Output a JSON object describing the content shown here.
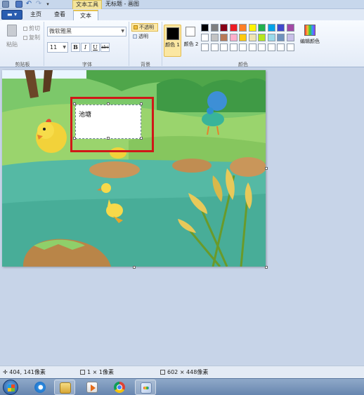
{
  "titlebar": {
    "context_tab": "文本工具",
    "window_title": "无标题 - 画图",
    "icons": [
      "app-menu-icon",
      "save-icon",
      "undo-icon",
      "redo-icon",
      "customize-dropdown-icon"
    ]
  },
  "tabs": {
    "file_icon": "file-menu-icon",
    "home": "主页",
    "view": "查看",
    "text": "文本"
  },
  "ribbon": {
    "clipboard": {
      "paste": "粘贴",
      "cut": "剪切",
      "copy": "复制",
      "group_label": "剪贴板"
    },
    "font": {
      "family": "微软雅黑",
      "size": "11",
      "bold": "B",
      "italic": "I",
      "underline": "U",
      "strikethrough": "abc",
      "group_label": "字体"
    },
    "background": {
      "opaque": "不透明",
      "transparent": "透明",
      "group_label": "背景"
    },
    "colors": {
      "color1_label": "颜色 1",
      "color2_label": "颜色 2",
      "color1_value": "#000000",
      "color2_value": "#ffffff",
      "edit_colors": "编辑颜色",
      "group_label": "颜色",
      "palette": [
        "#000000",
        "#7f7f7f",
        "#880015",
        "#ed1c24",
        "#ff7f27",
        "#fff200",
        "#22b14c",
        "#00a2e8",
        "#3f48cc",
        "#a349a4",
        "#ffffff",
        "#c3c3c3",
        "#b97a57",
        "#ffaec9",
        "#ffc90e",
        "#efe4b0",
        "#b5e61d",
        "#99d9ea",
        "#7092be",
        "#c8bfe7",
        "#ffffff",
        "#ffffff",
        "#ffffff",
        "#ffffff",
        "#ffffff",
        "#ffffff",
        "#ffffff",
        "#ffffff",
        "#ffffff",
        "#ffffff"
      ]
    }
  },
  "canvas": {
    "text_content": "池塘",
    "accent_highlight": "#d01818"
  },
  "status": {
    "cursor_position": "404, 141像素",
    "selection_size": "1 × 1像素",
    "image_size": "602 × 448像素"
  },
  "taskbar": {
    "items": [
      "start-icon",
      "ie-icon",
      "explorer-icon",
      "media-player-icon",
      "chrome-icon",
      "paint-icon"
    ]
  }
}
